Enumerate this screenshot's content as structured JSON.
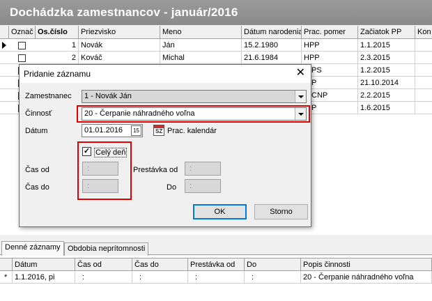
{
  "title": "Dochádzka zamestnancov - január/2016",
  "grid": {
    "columns": [
      "Označ",
      "Os.číslo",
      "Priezvisko",
      "Meno",
      "Dátum narodenia",
      "Prac. pomer",
      "Začiatok PP",
      "Kon"
    ],
    "rows": [
      {
        "os_cislo": "1",
        "priezvisko": "Novák",
        "meno": "Ján",
        "datum": "15.2.1980",
        "pomer": "HPP",
        "zaciatok": "1.1.2015"
      },
      {
        "os_cislo": "2",
        "priezvisko": "Kováč",
        "meno": "Michal",
        "datum": "21.6.1984",
        "pomer": "HPP",
        "zaciatok": "2.3.2015"
      },
      {
        "os_cislo": "",
        "priezvisko": "",
        "meno": "",
        "datum": "",
        "pomer": "PS",
        "zaciatok": "1.2.2015"
      },
      {
        "os_cislo": "",
        "priezvisko": "",
        "meno": "",
        "datum": "",
        "pomer": "P",
        "zaciatok": "21.10.2014"
      },
      {
        "os_cislo": "",
        "priezvisko": "",
        "meno": "",
        "datum": "",
        "pomer": "CNP",
        "zaciatok": "2.2.2015"
      },
      {
        "os_cislo": "",
        "priezvisko": "",
        "meno": "",
        "datum": "",
        "pomer": "P",
        "zaciatok": "1.6.2015"
      }
    ]
  },
  "dialog": {
    "title": "Pridanie záznamu",
    "close_symbol": "✕",
    "zamestnanec_label": "Zamestnanec",
    "zamestnanec_value": "1 - Novák Ján",
    "cinnost_label": "Činnosť",
    "cinnost_value": "20 - Čerpanie náhradného voľna",
    "datum_label": "Dátum",
    "datum_value": "01.01.2016",
    "datum_btn": "15",
    "calendar_link": "Prac. kalendár",
    "cely_den_label": "Celý deň",
    "cely_den_checked": "✓",
    "cas_od_label": "Čas od",
    "cas_od_value": ":",
    "cas_do_label": "Čas do",
    "cas_do_value": ":",
    "prestavka_od_label": "Prestávka od",
    "prestavka_od_value": ":",
    "do_label": "Do",
    "do_value": ":",
    "ok_label": "OK",
    "storno_label": "Storno",
    "highlight_color": "#e00000"
  },
  "tabs": [
    "Denné záznamy",
    "Obdobia neprítomnosti"
  ],
  "detail": {
    "columns": [
      "Dátum",
      "Čas od",
      "Čas do",
      "Prestávka od",
      "Do",
      "Popis činnosti"
    ],
    "row_marker": "*",
    "row": [
      "1.1.2016, pi",
      ":",
      ":",
      ":",
      ":",
      "20 - Čerpanie náhradného voľna"
    ]
  }
}
